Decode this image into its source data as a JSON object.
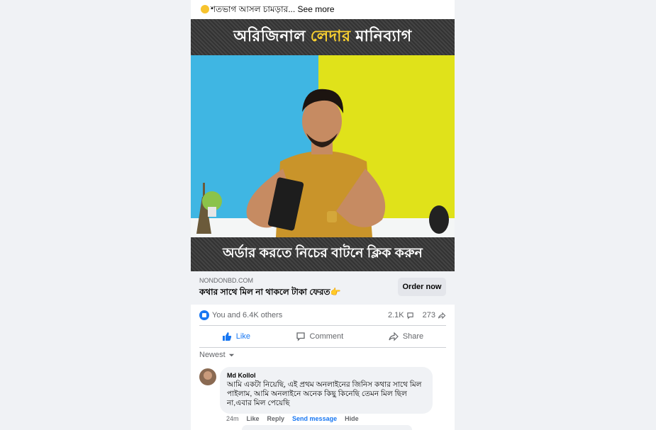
{
  "post": {
    "caption": "শতভাগ আসল চামড়ার...",
    "see_more": "See more"
  },
  "media": {
    "top_banner_prefix": "অরিজিনাল",
    "top_banner_highlight": "লেদার",
    "top_banner_suffix": "মানিব্যাগ",
    "bottom_banner": "অর্ডার করতে নিচের বাটনে ক্লিক করুন"
  },
  "link": {
    "domain": "NONDONBD.COM",
    "title": "কথার সাথে মিল না থাকলে টাকা ফেরত👉",
    "button": "Order now"
  },
  "reactions": {
    "summary": "You and 6.4K others",
    "comments": "2.1K",
    "shares": "273"
  },
  "actions": {
    "like": "Like",
    "comment": "Comment",
    "share": "Share"
  },
  "sort": {
    "label": "Newest"
  },
  "comment": {
    "author": "Md Kollol",
    "text": "আমি একটা নিয়েছি, এই প্রথম অনলাইনের জিনিস কথার সাথে মিল পাইলাম, আমি অনলাইনে অনেক কিছু কিনেছি তেমন মিল ছিল না,এবার মিল পেয়েছি",
    "time": "24m",
    "like": "Like",
    "reply": "Reply",
    "send_message": "Send message",
    "hide": "Hide"
  },
  "colors": {
    "accent": "#1877f2",
    "page_bg": "#f0f2f5",
    "banner_highlight": "#f9d030"
  }
}
